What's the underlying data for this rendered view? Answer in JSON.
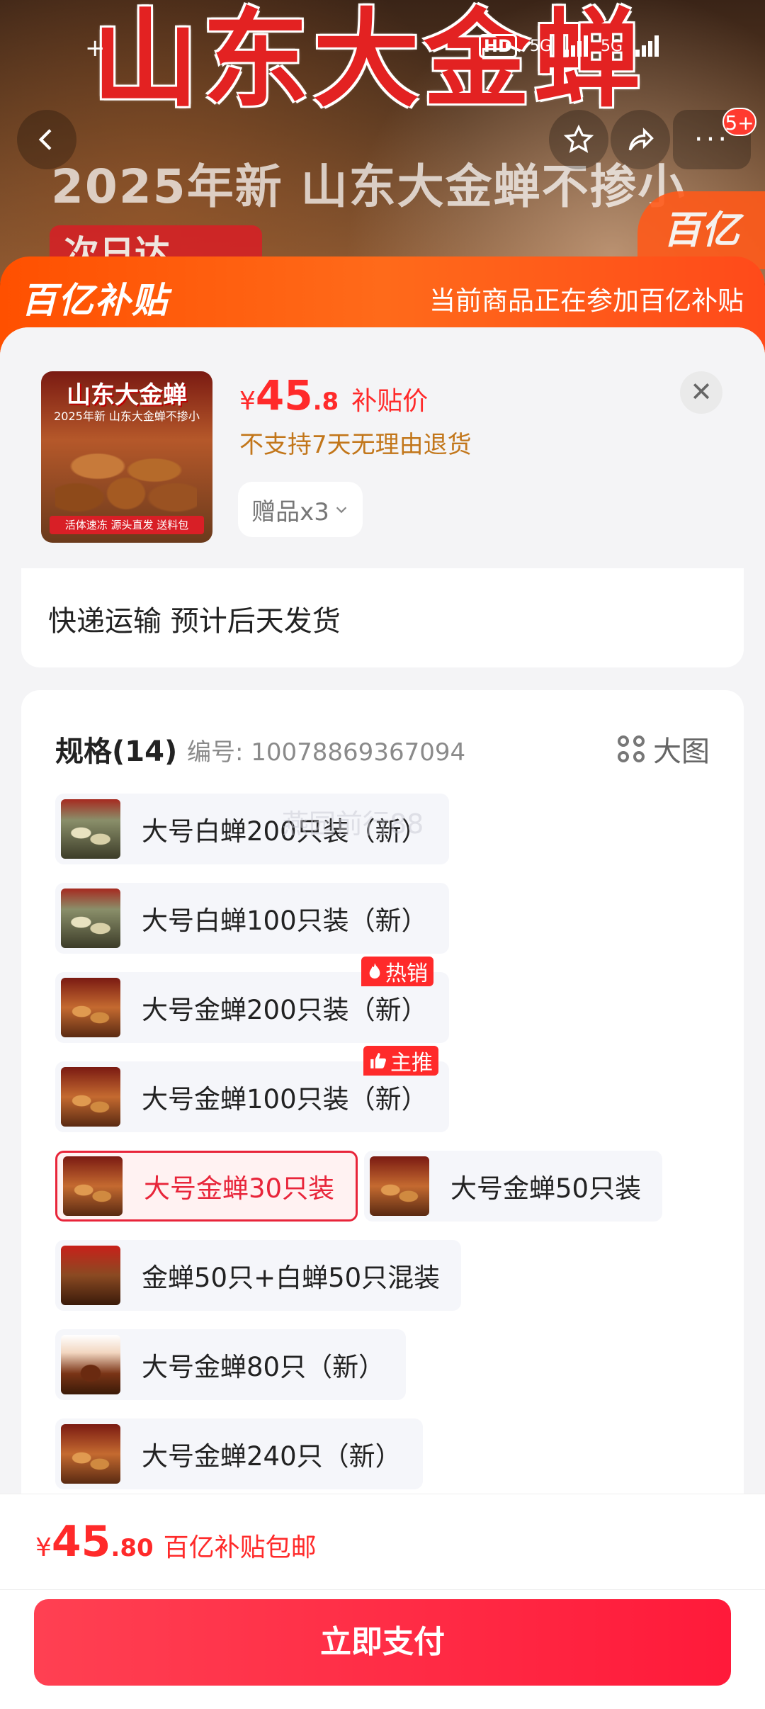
{
  "banner": {
    "title": "山东大金蝉",
    "subtitle": "2025年新 山东大金蝉不掺小",
    "badge": "次日达",
    "brand": "百亿"
  },
  "status": {
    "left": "+",
    "hd": "HD",
    "net1": "5G",
    "net2": "5G"
  },
  "nav": {
    "more": "···",
    "badge": "5+"
  },
  "subsidy": {
    "logo": "百亿补贴",
    "note": "当前商品正在参加百亿补贴"
  },
  "product": {
    "thumb_title": "山东大金蝉",
    "thumb_sub": "2025年新 山东大金蝉不掺小",
    "thumb_foot": "活体速冻 源头直发 送料包",
    "price_currency": "¥",
    "price_int": "45",
    "price_dec": ".8",
    "price_tag": "补贴价",
    "return_note": "不支持7天无理由退货",
    "gift_label": "赠品x3"
  },
  "delivery": {
    "text": "快递运输 预计后天发货"
  },
  "spec": {
    "title": "规格(14)",
    "code": "编号: 10078869367094",
    "big_view": "大图",
    "options": [
      {
        "label": "大号白蝉200只装（新）"
      },
      {
        "label": "大号白蝉100只装（新）"
      },
      {
        "label": "大号金蝉200只装（新）",
        "tag": "热销"
      },
      {
        "label": "大号金蝉100只装（新）",
        "tag": "主推"
      },
      {
        "label": "大号金蝉30只装",
        "selected": true
      },
      {
        "label": "大号金蝉50只装"
      },
      {
        "label": "金蝉50只+白蝉50只混装"
      },
      {
        "label": "大号金蝉80只（新）"
      },
      {
        "label": "大号金蝉240只（新）"
      }
    ]
  },
  "watermark": "燕园前行88",
  "bottom": {
    "currency": "¥",
    "int": "45",
    "dec": ".80",
    "tag": "百亿补贴包邮",
    "pay_label": "立即支付"
  },
  "colors": {
    "accent_red": "#ff2a2a",
    "subsidy_orange": "#ff5000",
    "pay_button": "#ff1a3a",
    "selected_border": "#e8253a",
    "return_note": "#c2761a"
  }
}
